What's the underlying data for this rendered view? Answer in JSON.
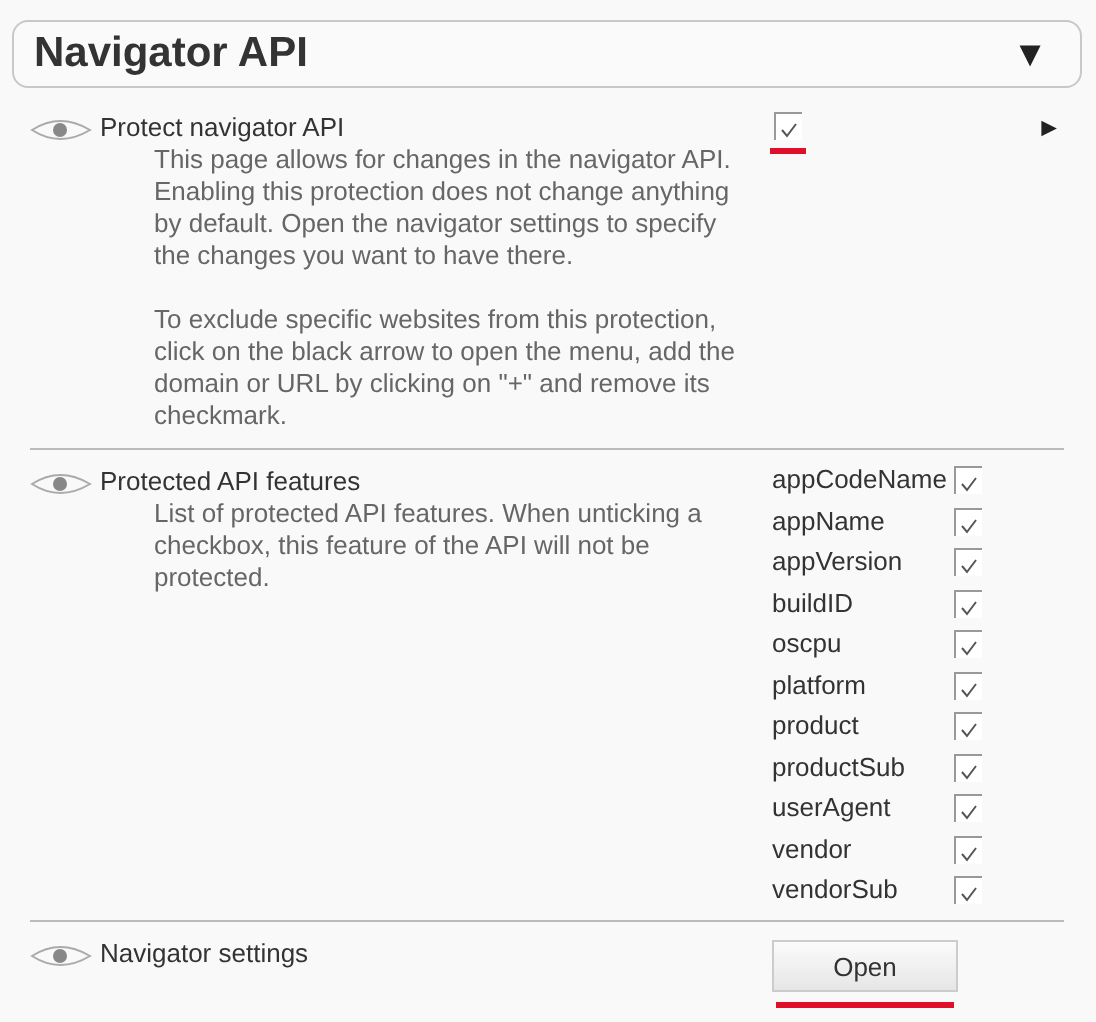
{
  "header": {
    "title": "Navigator API",
    "caret": "▼"
  },
  "sections": [
    {
      "kind": "toggle",
      "title": "Protect navigator API",
      "description": [
        "This page allows for changes in the navigator API. Enabling this protection does not change anything by default. Open the navigator settings to specify the changes you want to have there.",
        "To exclude specific websites from this protection, click on the black arrow to open the menu, add the domain or URL by clicking on \"+\" and remove its checkmark."
      ],
      "checked": true,
      "underlined": true,
      "arrow": "►"
    },
    {
      "kind": "features",
      "title": "Protected API features",
      "description": [
        "List of protected API features. When unticking a checkbox, this feature of the API will not be protected."
      ],
      "features": [
        {
          "name": "appCodeName",
          "checked": true
        },
        {
          "name": "appName",
          "checked": true
        },
        {
          "name": "appVersion",
          "checked": true
        },
        {
          "name": "buildID",
          "checked": true
        },
        {
          "name": "oscpu",
          "checked": true
        },
        {
          "name": "platform",
          "checked": true
        },
        {
          "name": "product",
          "checked": true
        },
        {
          "name": "productSub",
          "checked": true
        },
        {
          "name": "userAgent",
          "checked": true
        },
        {
          "name": "vendor",
          "checked": true
        },
        {
          "name": "vendorSub",
          "checked": true
        }
      ]
    },
    {
      "kind": "button",
      "title": "Navigator settings",
      "button": "Open",
      "underlined": true
    }
  ]
}
